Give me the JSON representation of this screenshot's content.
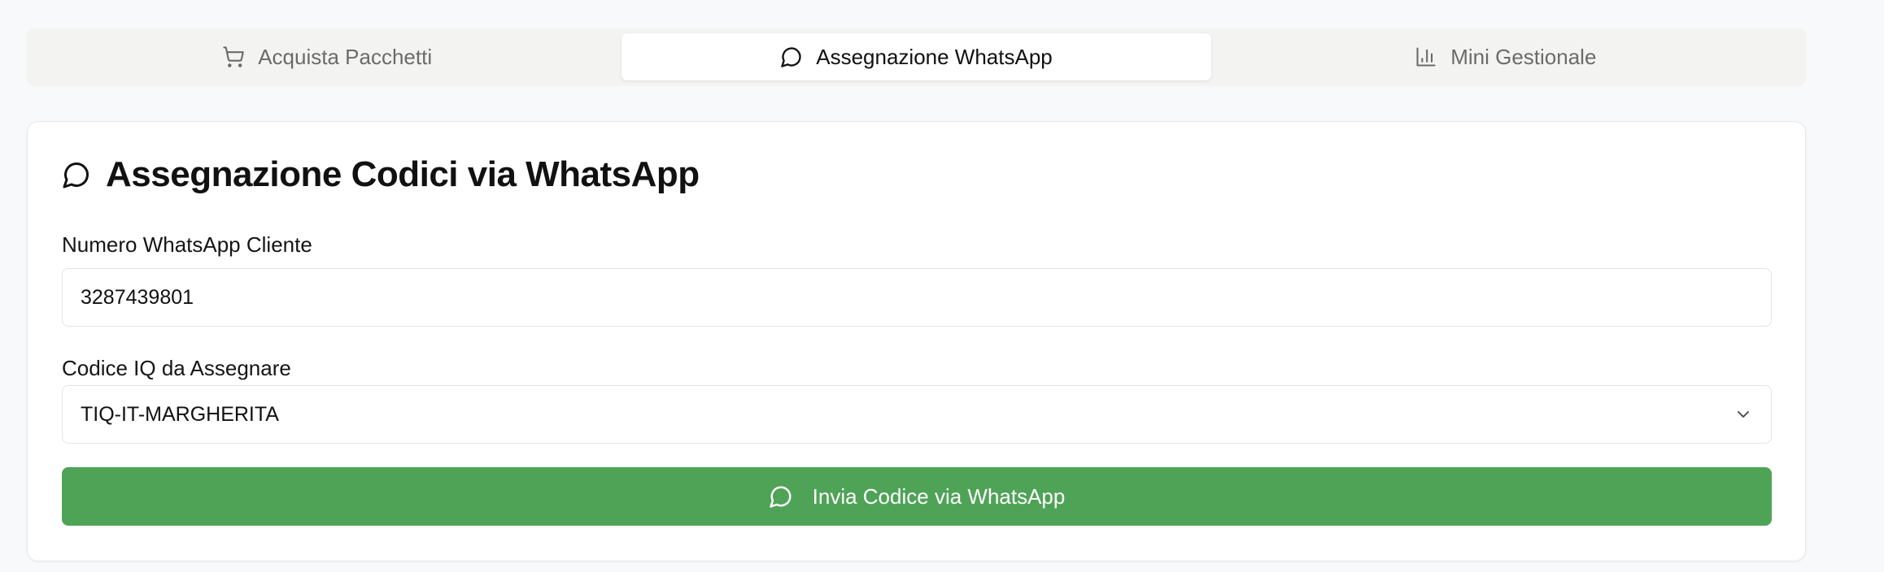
{
  "tabs": [
    {
      "label": "Acquista Pacchetti",
      "icon": "cart-icon",
      "active": false
    },
    {
      "label": "Assegnazione WhatsApp",
      "icon": "message-circle-icon",
      "active": true
    },
    {
      "label": "Mini Gestionale",
      "icon": "bar-chart-icon",
      "active": false
    }
  ],
  "card": {
    "title": "Assegnazione Codici via WhatsApp",
    "title_icon": "message-circle-icon"
  },
  "form": {
    "number_label": "Numero WhatsApp Cliente",
    "number_value": "3287439801",
    "code_label": "Codice IQ da Assegnare",
    "code_selected": "TIQ-IT-MARGHERITA",
    "submit_label": "Invia Codice via WhatsApp",
    "submit_icon": "message-circle-icon"
  },
  "colors": {
    "accent_green": "#4fa357",
    "tab_bar_bg": "#f3f3f1",
    "page_bg": "#f8f9fb"
  }
}
